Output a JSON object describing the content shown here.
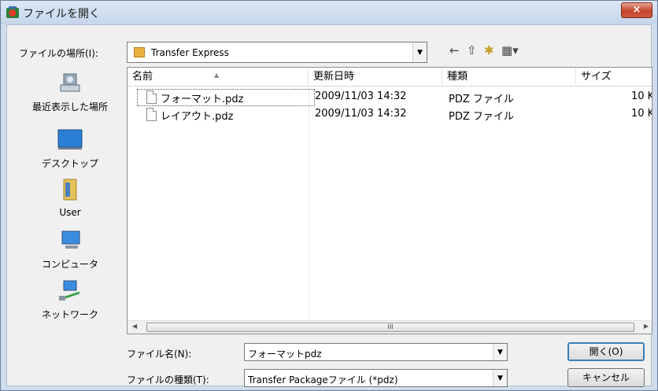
{
  "window": {
    "title": "ファイルを開く",
    "close_glyph": "×"
  },
  "lookin": {
    "label": "ファイルの場所(I):",
    "value": "Transfer Express",
    "dropdown_glyph": "▼"
  },
  "toolbar": {
    "back_glyph": "←",
    "up_glyph": "⇧",
    "newfolder_glyph": "✱",
    "view_glyph": "▦▾"
  },
  "places": [
    {
      "label": "最近表示した場所",
      "icon": "recent-places-icon"
    },
    {
      "label": "デスクトップ",
      "icon": "desktop-icon"
    },
    {
      "label": "User",
      "icon": "user-folder-icon"
    },
    {
      "label": "コンピュータ",
      "icon": "computer-icon"
    },
    {
      "label": "ネットワーク",
      "icon": "network-icon"
    }
  ],
  "columns": {
    "name": "名前",
    "modified": "更新日時",
    "type": "種類",
    "size": "サイズ",
    "sort_glyph": "▲"
  },
  "files": [
    {
      "name": "フォーマット.pdz",
      "modified": "2009/11/03 14:32",
      "type": "PDZ ファイル",
      "size": "10 K"
    },
    {
      "name": "レイアウト.pdz",
      "modified": "2009/11/03 14:32",
      "type": "PDZ ファイル",
      "size": "10 K"
    }
  ],
  "scrollbar": {
    "left_glyph": "◀",
    "right_glyph": "▶",
    "grip": "III"
  },
  "filename": {
    "label": "ファイル名(N):",
    "value": "フォーマットpdz"
  },
  "filetype": {
    "label": "ファイルの種類(T):",
    "value": "Transfer Packageファイル (*pdz)"
  },
  "buttons": {
    "open": "開く(O)",
    "cancel": "キャンセル"
  },
  "colors": {
    "titlebar": "#c6d6ea",
    "close": "#c4432b",
    "selection_focus": "#555555"
  }
}
